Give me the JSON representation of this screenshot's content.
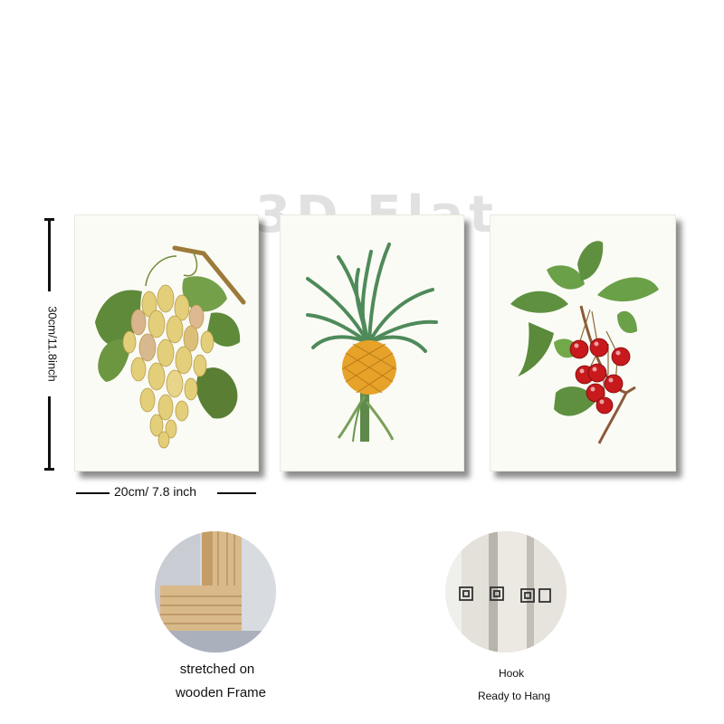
{
  "watermark": "3D Flat",
  "dimensions": {
    "height_label": "30cm/11.8inch",
    "width_label": "20cm/ 7.8 inch"
  },
  "prints": [
    {
      "subject": "grapes",
      "icon": "grapes-illustration"
    },
    {
      "subject": "pineapple",
      "icon": "pineapple-illustration"
    },
    {
      "subject": "cherries",
      "icon": "cherries-illustration"
    }
  ],
  "details": [
    {
      "caption_line1": "stretched on",
      "caption_line2": "wooden Frame",
      "icon": "wooden-frame-photo"
    },
    {
      "caption_line1": "Hook",
      "caption_line2": "Ready to Hang",
      "icon": "hook-photo"
    }
  ],
  "colors": {
    "background": "#ffffff",
    "canvas": "#fbfbf5",
    "leaf_green": "#5e8a3a",
    "grape_yellow": "#e3cf7a",
    "cherry_red": "#c8191c",
    "pineapple_orange": "#e6a229",
    "wood": "#d9b98a"
  }
}
